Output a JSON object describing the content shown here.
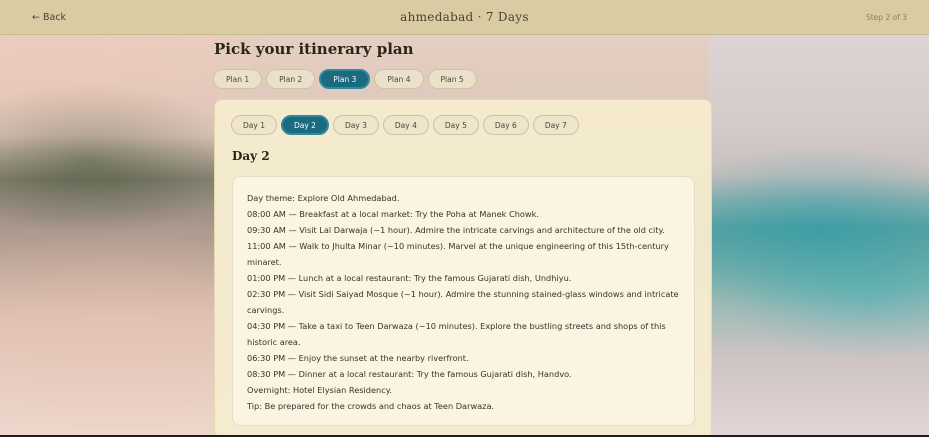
{
  "header": {
    "back_label": "← Back",
    "title": "ahmedabad · 7 Days",
    "step": "Step 2 of 3"
  },
  "page": {
    "title": "Pick your itinerary plan"
  },
  "plans": {
    "tabs": [
      "Plan 1",
      "Plan 2",
      "Plan 3",
      "Plan 4",
      "Plan 5"
    ],
    "selected": "Plan 3"
  },
  "days": {
    "tabs": [
      "Day 1",
      "Day 2",
      "Day 3",
      "Day 4",
      "Day 5",
      "Day 6",
      "Day 7"
    ],
    "selected": "Day 2",
    "heading": "Day 2"
  },
  "itinerary": {
    "lines": [
      "Day theme: Explore Old Ahmedabad.",
      "08:00 AM — Breakfast at a local market: Try the Poha at Manek Chowk.",
      "09:30 AM — Visit Lal Darwaja (~1 hour). Admire the intricate carvings and architecture of the old city.",
      "11:00 AM — Walk to Jhulta Minar (~10 minutes). Marvel at the unique engineering of this 15th-century",
      "minaret.",
      "01:00 PM — Lunch at a local restaurant: Try the famous Gujarati dish, Undhiyu.",
      "02:30 PM — Visit Sidi Saiyad Mosque (~1 hour). Admire the stunning stained-glass windows and intricate",
      "carvings.",
      "04:30 PM — Take a taxi to Teen Darwaza (~10 minutes). Explore the bustling streets and shops of this",
      "historic area.",
      "06:30 PM — Enjoy the sunset at the nearby riverfront.",
      "08:30 PM — Dinner at a local restaurant: Try the famous Gujarati dish, Handvo.",
      "Overnight: Hotel Elysian Residency.",
      "Tip: Be prepared for the crowds and chaos at Teen Darwaza."
    ]
  },
  "colors": {
    "accent": "#1b6a7e",
    "header_bg": "#d9cca3",
    "card_bg": "#f5eccf"
  }
}
